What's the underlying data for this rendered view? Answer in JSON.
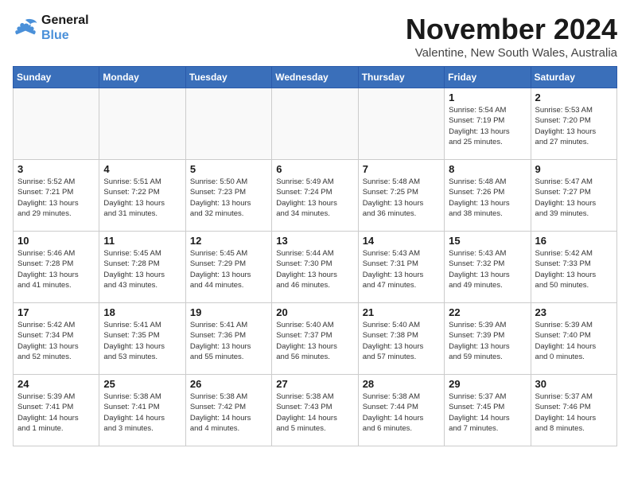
{
  "header": {
    "logo_line1": "General",
    "logo_line2": "Blue",
    "title": "November 2024",
    "subtitle": "Valentine, New South Wales, Australia"
  },
  "weekdays": [
    "Sunday",
    "Monday",
    "Tuesday",
    "Wednesday",
    "Thursday",
    "Friday",
    "Saturday"
  ],
  "weeks": [
    [
      {
        "day": "",
        "info": ""
      },
      {
        "day": "",
        "info": ""
      },
      {
        "day": "",
        "info": ""
      },
      {
        "day": "",
        "info": ""
      },
      {
        "day": "",
        "info": ""
      },
      {
        "day": "1",
        "info": "Sunrise: 5:54 AM\nSunset: 7:19 PM\nDaylight: 13 hours\nand 25 minutes."
      },
      {
        "day": "2",
        "info": "Sunrise: 5:53 AM\nSunset: 7:20 PM\nDaylight: 13 hours\nand 27 minutes."
      }
    ],
    [
      {
        "day": "3",
        "info": "Sunrise: 5:52 AM\nSunset: 7:21 PM\nDaylight: 13 hours\nand 29 minutes."
      },
      {
        "day": "4",
        "info": "Sunrise: 5:51 AM\nSunset: 7:22 PM\nDaylight: 13 hours\nand 31 minutes."
      },
      {
        "day": "5",
        "info": "Sunrise: 5:50 AM\nSunset: 7:23 PM\nDaylight: 13 hours\nand 32 minutes."
      },
      {
        "day": "6",
        "info": "Sunrise: 5:49 AM\nSunset: 7:24 PM\nDaylight: 13 hours\nand 34 minutes."
      },
      {
        "day": "7",
        "info": "Sunrise: 5:48 AM\nSunset: 7:25 PM\nDaylight: 13 hours\nand 36 minutes."
      },
      {
        "day": "8",
        "info": "Sunrise: 5:48 AM\nSunset: 7:26 PM\nDaylight: 13 hours\nand 38 minutes."
      },
      {
        "day": "9",
        "info": "Sunrise: 5:47 AM\nSunset: 7:27 PM\nDaylight: 13 hours\nand 39 minutes."
      }
    ],
    [
      {
        "day": "10",
        "info": "Sunrise: 5:46 AM\nSunset: 7:28 PM\nDaylight: 13 hours\nand 41 minutes."
      },
      {
        "day": "11",
        "info": "Sunrise: 5:45 AM\nSunset: 7:28 PM\nDaylight: 13 hours\nand 43 minutes."
      },
      {
        "day": "12",
        "info": "Sunrise: 5:45 AM\nSunset: 7:29 PM\nDaylight: 13 hours\nand 44 minutes."
      },
      {
        "day": "13",
        "info": "Sunrise: 5:44 AM\nSunset: 7:30 PM\nDaylight: 13 hours\nand 46 minutes."
      },
      {
        "day": "14",
        "info": "Sunrise: 5:43 AM\nSunset: 7:31 PM\nDaylight: 13 hours\nand 47 minutes."
      },
      {
        "day": "15",
        "info": "Sunrise: 5:43 AM\nSunset: 7:32 PM\nDaylight: 13 hours\nand 49 minutes."
      },
      {
        "day": "16",
        "info": "Sunrise: 5:42 AM\nSunset: 7:33 PM\nDaylight: 13 hours\nand 50 minutes."
      }
    ],
    [
      {
        "day": "17",
        "info": "Sunrise: 5:42 AM\nSunset: 7:34 PM\nDaylight: 13 hours\nand 52 minutes."
      },
      {
        "day": "18",
        "info": "Sunrise: 5:41 AM\nSunset: 7:35 PM\nDaylight: 13 hours\nand 53 minutes."
      },
      {
        "day": "19",
        "info": "Sunrise: 5:41 AM\nSunset: 7:36 PM\nDaylight: 13 hours\nand 55 minutes."
      },
      {
        "day": "20",
        "info": "Sunrise: 5:40 AM\nSunset: 7:37 PM\nDaylight: 13 hours\nand 56 minutes."
      },
      {
        "day": "21",
        "info": "Sunrise: 5:40 AM\nSunset: 7:38 PM\nDaylight: 13 hours\nand 57 minutes."
      },
      {
        "day": "22",
        "info": "Sunrise: 5:39 AM\nSunset: 7:39 PM\nDaylight: 13 hours\nand 59 minutes."
      },
      {
        "day": "23",
        "info": "Sunrise: 5:39 AM\nSunset: 7:40 PM\nDaylight: 14 hours\nand 0 minutes."
      }
    ],
    [
      {
        "day": "24",
        "info": "Sunrise: 5:39 AM\nSunset: 7:41 PM\nDaylight: 14 hours\nand 1 minute."
      },
      {
        "day": "25",
        "info": "Sunrise: 5:38 AM\nSunset: 7:41 PM\nDaylight: 14 hours\nand 3 minutes."
      },
      {
        "day": "26",
        "info": "Sunrise: 5:38 AM\nSunset: 7:42 PM\nDaylight: 14 hours\nand 4 minutes."
      },
      {
        "day": "27",
        "info": "Sunrise: 5:38 AM\nSunset: 7:43 PM\nDaylight: 14 hours\nand 5 minutes."
      },
      {
        "day": "28",
        "info": "Sunrise: 5:38 AM\nSunset: 7:44 PM\nDaylight: 14 hours\nand 6 minutes."
      },
      {
        "day": "29",
        "info": "Sunrise: 5:37 AM\nSunset: 7:45 PM\nDaylight: 14 hours\nand 7 minutes."
      },
      {
        "day": "30",
        "info": "Sunrise: 5:37 AM\nSunset: 7:46 PM\nDaylight: 14 hours\nand 8 minutes."
      }
    ]
  ]
}
